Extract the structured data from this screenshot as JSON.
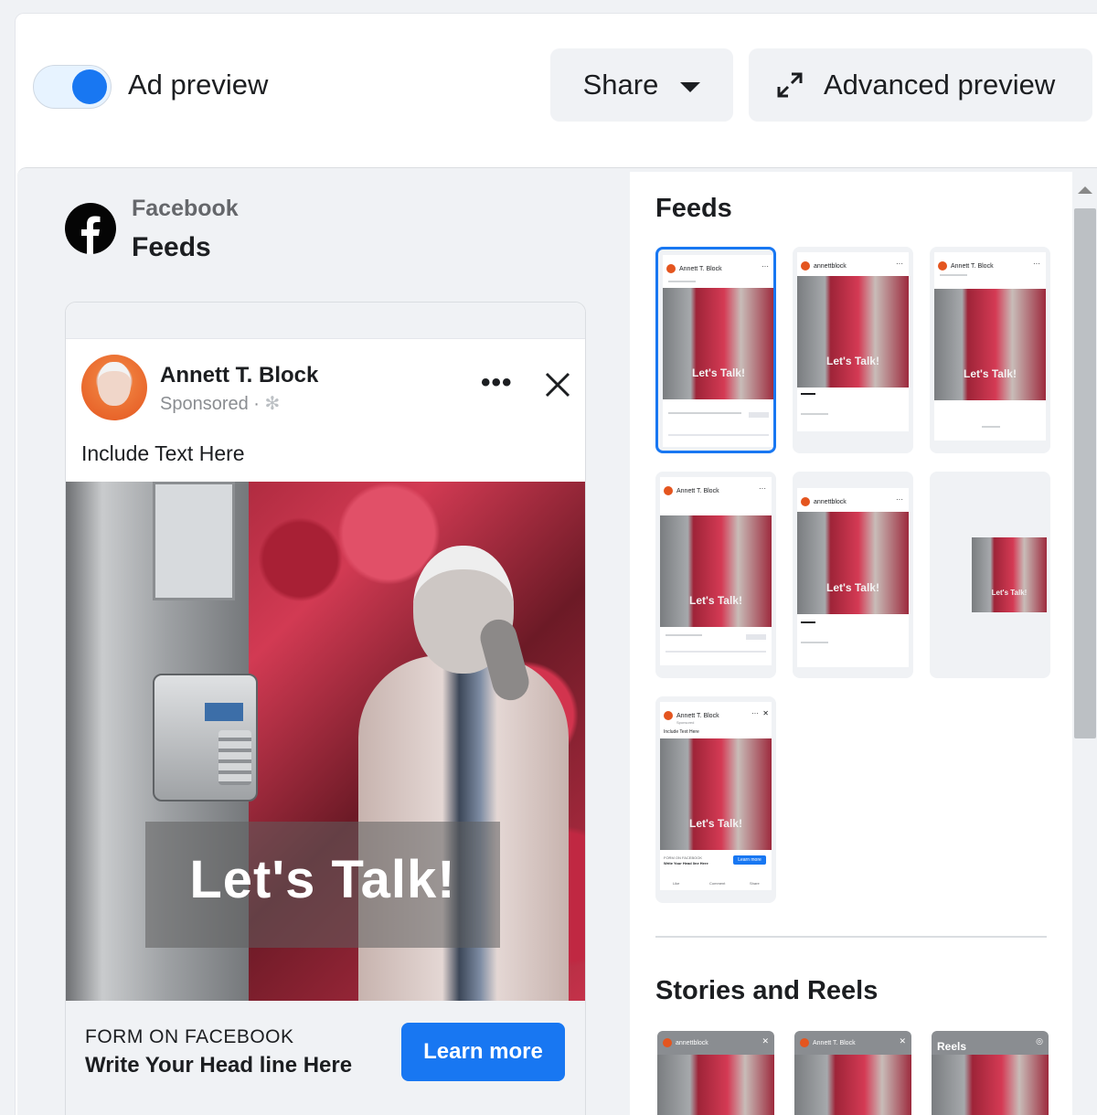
{
  "topbar": {
    "toggle_on": true,
    "ad_preview_label": "Ad preview",
    "share_label": "Share",
    "advanced_preview_label": "Advanced preview"
  },
  "left_panel": {
    "platform": "Facebook",
    "placement": "Feeds"
  },
  "ad": {
    "author": "Annett T. Block",
    "sponsored": "Sponsored · ",
    "primary_text": "Include Text Here",
    "creative_overlay": "Let's Talk!",
    "form_label": "FORM ON FACEBOOK",
    "headline": "Write Your Head line Here",
    "cta": "Learn more"
  },
  "right_panel": {
    "feeds_title": "Feeds",
    "stories_title": "Stories and Reels",
    "thumbnails": [
      {
        "header": "Annett T. Block",
        "overlay": "Let's Talk!",
        "selected": true
      },
      {
        "header": "annettblock",
        "overlay": "Let's Talk!",
        "selected": false
      },
      {
        "header": "Annett T. Block",
        "overlay": "Let's Talk!",
        "selected": false
      },
      {
        "header": "Annett T. Block",
        "overlay": "Let's Talk!",
        "selected": false
      },
      {
        "header": "annettblock",
        "overlay": "Let's Talk!",
        "selected": false
      },
      {
        "header": "",
        "overlay": "Let's Talk!",
        "selected": false
      },
      {
        "header": "Annett T. Block",
        "overlay": "Let's Talk!",
        "selected": false
      }
    ],
    "thumb7": {
      "sub": "Sponsored",
      "primary_text": "Include Text Here",
      "form_label": "FORM ON FACEBOOK",
      "headline": "Write Your Head line Here",
      "cta": "Learn more",
      "actions": [
        "Like",
        "Comment",
        "Share"
      ]
    },
    "stories": [
      {
        "header": "annettblock"
      },
      {
        "header": "Annett T. Block"
      },
      {
        "header": "Reels"
      }
    ]
  },
  "colors": {
    "accent": "#1877f2",
    "background": "#f0f2f5",
    "text": "#1c1e21",
    "muted": "#65676b"
  },
  "icons": [
    "facebook-logo-icon",
    "caret-down-icon",
    "expand-arrows-icon",
    "more-dots-icon",
    "close-icon",
    "gear-icon",
    "scroll-up-icon"
  ]
}
